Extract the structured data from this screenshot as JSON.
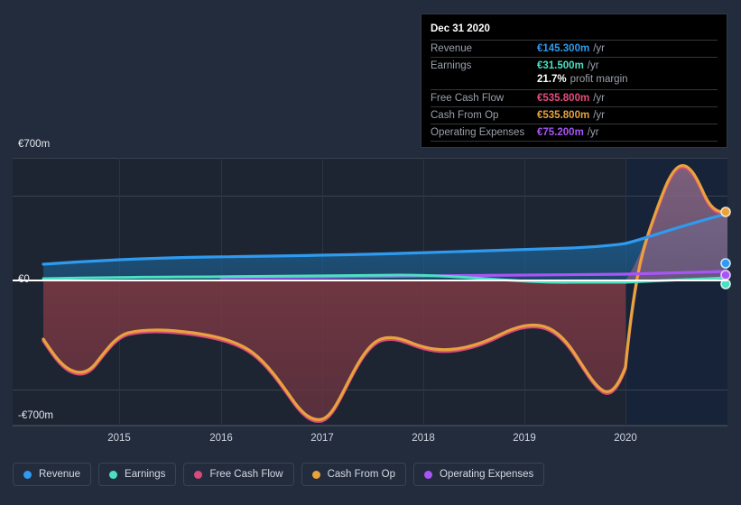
{
  "tooltip": {
    "date": "Dec 31 2020",
    "rows": [
      {
        "label": "Revenue",
        "value": "€145.300m",
        "unit": "/yr",
        "color": "#2e9bf0"
      },
      {
        "label": "Earnings",
        "value": "€31.500m",
        "unit": "/yr",
        "color": "#4be0c0"
      },
      {
        "label": "",
        "value": "21.7%",
        "unit": "profit margin",
        "color": "#ffffff",
        "sub": true
      },
      {
        "label": "Free Cash Flow",
        "value": "€535.800m",
        "unit": "/yr",
        "color": "#e84d7f"
      },
      {
        "label": "Cash From Op",
        "value": "€535.800m",
        "unit": "/yr",
        "color": "#e8a33d"
      },
      {
        "label": "Operating Expenses",
        "value": "€75.200m",
        "unit": "/yr",
        "color": "#a855f7"
      }
    ]
  },
  "legend": {
    "items": [
      {
        "label": "Revenue",
        "color": "#2e9bf0"
      },
      {
        "label": "Earnings",
        "color": "#4be0c0"
      },
      {
        "label": "Free Cash Flow",
        "color": "#d94a7a"
      },
      {
        "label": "Cash From Op",
        "color": "#e8a33d"
      },
      {
        "label": "Operating Expenses",
        "color": "#a855f7"
      }
    ]
  },
  "chart_data": {
    "type": "area",
    "title": "",
    "xlabel": "",
    "ylabel": "",
    "ylim": [
      -700,
      700
    ],
    "y_ticks": [
      {
        "label": "€700m",
        "value": 700
      },
      {
        "label": "€0",
        "value": 0
      },
      {
        "label": "-€700m",
        "value": -700
      }
    ],
    "y_gridlines": [
      700,
      350,
      -350,
      -700
    ],
    "x_ticks": [
      "2015",
      "2016",
      "2017",
      "2018",
      "2019",
      "2020"
    ],
    "x_range": [
      "2014-06",
      "2021-06"
    ],
    "currency": "EUR",
    "units": "millions",
    "grid": true,
    "legend_position": "bottom",
    "forecast_region": {
      "from": "2020-03",
      "label": ""
    },
    "series": [
      {
        "name": "Revenue",
        "color": "#2e9bf0",
        "x": [
          "2014-07",
          "2015-01",
          "2015-07",
          "2016-01",
          "2016-07",
          "2017-01",
          "2017-07",
          "2018-01",
          "2018-07",
          "2019-01",
          "2019-07",
          "2020-01",
          "2020-07",
          "2021-01",
          "2021-06"
        ],
        "values": [
          76,
          80,
          84,
          86,
          88,
          90,
          92,
          95,
          98,
          103,
          108,
          115,
          128,
          140,
          145.3
        ]
      },
      {
        "name": "Earnings",
        "color": "#4be0c0",
        "x": [
          "2014-07",
          "2015-01",
          "2015-07",
          "2016-01",
          "2016-07",
          "2017-01",
          "2017-07",
          "2018-01",
          "2018-07",
          "2019-01",
          "2019-07",
          "2020-01",
          "2020-07",
          "2021-01",
          "2021-06"
        ],
        "values": [
          8,
          9,
          10,
          11,
          12,
          13,
          14,
          15,
          16,
          18,
          20,
          23,
          26,
          29,
          31.5
        ]
      },
      {
        "name": "Free Cash Flow",
        "color": "#d94a7a",
        "x": [
          "2014-07",
          "2015-01",
          "2015-07",
          "2016-01",
          "2016-07",
          "2017-01",
          "2017-07",
          "2018-01",
          "2018-07",
          "2019-01",
          "2019-07",
          "2020-01",
          "2020-07",
          "2021-01",
          "2021-06"
        ],
        "values": [
          -290,
          -380,
          -330,
          -180,
          -190,
          -275,
          -400,
          -700,
          -450,
          -490,
          -370,
          -560,
          -420,
          480,
          535.8
        ]
      },
      {
        "name": "Cash From Op",
        "color": "#e8a33d",
        "x": [
          "2014-07",
          "2015-01",
          "2015-07",
          "2016-01",
          "2016-07",
          "2017-01",
          "2017-07",
          "2018-01",
          "2018-07",
          "2019-01",
          "2019-07",
          "2020-01",
          "2020-07",
          "2021-01",
          "2021-06"
        ],
        "values": [
          -290,
          -380,
          -330,
          -180,
          -190,
          -275,
          -400,
          -700,
          -450,
          -490,
          -370,
          -560,
          -420,
          480,
          535.8
        ]
      },
      {
        "name": "Operating Expenses",
        "color": "#a855f7",
        "x": [
          "2016-01",
          "2016-07",
          "2017-01",
          "2017-07",
          "2018-01",
          "2018-07",
          "2019-01",
          "2019-07",
          "2020-01",
          "2020-07",
          "2021-01",
          "2021-06"
        ],
        "values": [
          32,
          34,
          36,
          39,
          42,
          46,
          50,
          55,
          60,
          66,
          71,
          75.2
        ]
      }
    ],
    "endpoint_markers": [
      {
        "series": "Cash From Op",
        "value": 535.8,
        "color": "#e8a33d"
      },
      {
        "series": "Revenue",
        "value": 145.3,
        "color": "#2e9bf0"
      },
      {
        "series": "Operating Expenses",
        "value": 75.2,
        "color": "#a855f7"
      },
      {
        "series": "Earnings",
        "value": 31.5,
        "color": "#4be0c0"
      }
    ]
  }
}
